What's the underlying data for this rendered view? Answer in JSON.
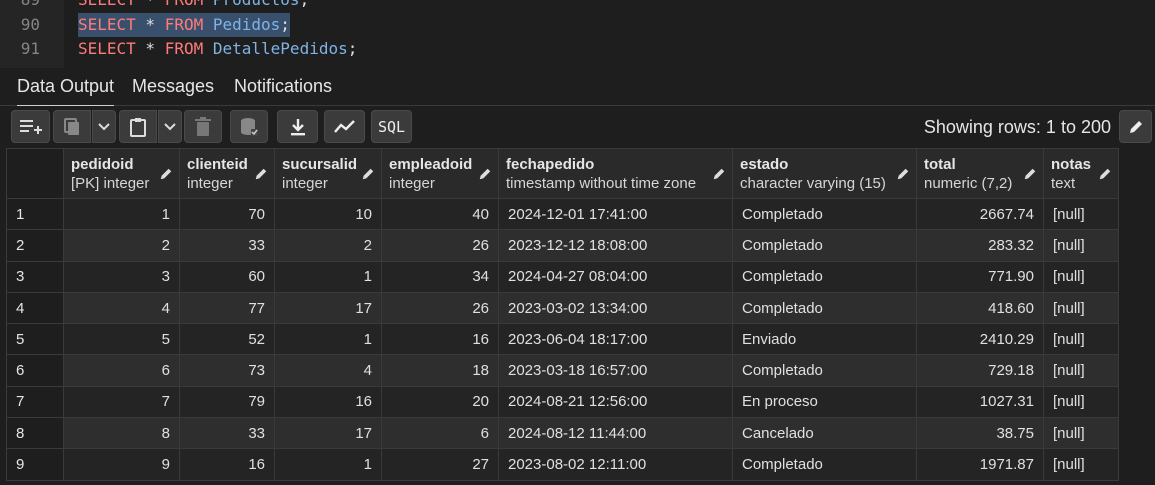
{
  "editor": {
    "lines": [
      {
        "num": "89",
        "kw1": "SELECT",
        "star": " * ",
        "kw2": "FROM",
        "table": " Productos",
        "end": ";"
      },
      {
        "num": "90",
        "kw1": "SELECT",
        "star": " * ",
        "kw2": "FROM",
        "table": " Pedidos",
        "end": ";"
      },
      {
        "num": "91",
        "kw1": "SELECT",
        "star": " * ",
        "kw2": "FROM",
        "table": " DetallePedidos",
        "end": ";"
      }
    ]
  },
  "tabs": {
    "data_output": "Data Output",
    "messages": "Messages",
    "notifications": "Notifications"
  },
  "toolbar": {
    "showing_rows": "Showing rows: 1 to 200",
    "sql_label": "SQL"
  },
  "columns": [
    {
      "name": "pedidoid",
      "type": "[PK] integer"
    },
    {
      "name": "clienteid",
      "type": "integer"
    },
    {
      "name": "sucursalid",
      "type": "integer"
    },
    {
      "name": "empleadoid",
      "type": "integer"
    },
    {
      "name": "fechapedido",
      "type": "timestamp without time zone"
    },
    {
      "name": "estado",
      "type": "character varying (15)"
    },
    {
      "name": "total",
      "type": "numeric (7,2)"
    },
    {
      "name": "notas",
      "type": "text"
    }
  ],
  "rows": [
    {
      "n": "1",
      "pedidoid": "1",
      "clienteid": "70",
      "sucursalid": "10",
      "empleadoid": "40",
      "fechapedido": "2024-12-01 17:41:00",
      "estado": "Completado",
      "total": "2667.74",
      "notas": "[null]"
    },
    {
      "n": "2",
      "pedidoid": "2",
      "clienteid": "33",
      "sucursalid": "2",
      "empleadoid": "26",
      "fechapedido": "2023-12-12 18:08:00",
      "estado": "Completado",
      "total": "283.32",
      "notas": "[null]"
    },
    {
      "n": "3",
      "pedidoid": "3",
      "clienteid": "60",
      "sucursalid": "1",
      "empleadoid": "34",
      "fechapedido": "2024-04-27 08:04:00",
      "estado": "Completado",
      "total": "771.90",
      "notas": "[null]"
    },
    {
      "n": "4",
      "pedidoid": "4",
      "clienteid": "77",
      "sucursalid": "17",
      "empleadoid": "26",
      "fechapedido": "2023-03-02 13:34:00",
      "estado": "Completado",
      "total": "418.60",
      "notas": "[null]"
    },
    {
      "n": "5",
      "pedidoid": "5",
      "clienteid": "52",
      "sucursalid": "1",
      "empleadoid": "16",
      "fechapedido": "2023-06-04 18:17:00",
      "estado": "Enviado",
      "total": "2410.29",
      "notas": "[null]"
    },
    {
      "n": "6",
      "pedidoid": "6",
      "clienteid": "73",
      "sucursalid": "4",
      "empleadoid": "18",
      "fechapedido": "2023-03-18 16:57:00",
      "estado": "Completado",
      "total": "729.18",
      "notas": "[null]"
    },
    {
      "n": "7",
      "pedidoid": "7",
      "clienteid": "79",
      "sucursalid": "16",
      "empleadoid": "20",
      "fechapedido": "2024-08-21 12:56:00",
      "estado": "En proceso",
      "total": "1027.31",
      "notas": "[null]"
    },
    {
      "n": "8",
      "pedidoid": "8",
      "clienteid": "33",
      "sucursalid": "17",
      "empleadoid": "6",
      "fechapedido": "2024-08-12 11:44:00",
      "estado": "Cancelado",
      "total": "38.75",
      "notas": "[null]"
    },
    {
      "n": "9",
      "pedidoid": "9",
      "clienteid": "16",
      "sucursalid": "1",
      "empleadoid": "27",
      "fechapedido": "2023-08-02 12:11:00",
      "estado": "Completado",
      "total": "1971.87",
      "notas": "[null]"
    }
  ]
}
